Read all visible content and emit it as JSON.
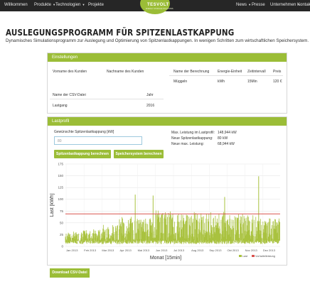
{
  "nav": {
    "left": [
      {
        "label": "Willkommen",
        "caret": false
      },
      {
        "label": "Produkte",
        "caret": true
      },
      {
        "label": "Technologien",
        "caret": true
      },
      {
        "label": "Projekte",
        "caret": false
      }
    ],
    "right": [
      {
        "label": "News",
        "caret": true
      },
      {
        "label": "Presse",
        "caret": false
      },
      {
        "label": "Unternehmen",
        "caret": true
      },
      {
        "label": "Kontakt",
        "caret": false
      }
    ],
    "logo": "TESVOLT",
    "logo_sub": "ENERGY STORAGE SOLUTIONS"
  },
  "page": {
    "title": "AUSLEGUNGSPROGRAMM FÜR SPITZENLASTKAPPUNG",
    "subtitle": "Dynamisches Simulationsprogramm zur Auslegung und Optimierung von Spitzenlastkappungen. In wenigen Schritten zum wirtschaftlichen Speichersystem."
  },
  "settings": {
    "header": "Einstellungen",
    "customer_first_label": "Vorname des Kunden",
    "customer_last_label": "Nachname des Kunden",
    "calc_name_label": "Name der Berechnung",
    "energy_unit_label": "Energie-Einheit",
    "time_interval_label": "Zeitintervall",
    "price_label": "Preis",
    "calc_name_value": "Müggeln",
    "energy_unit_value": "kWh",
    "time_interval_value": "15Min",
    "price_value": "120 €",
    "csv_name_label": "Name der CSV-Datei",
    "year_label": "Jahr",
    "csv_name_value": "Lastgang",
    "year_value": "2016"
  },
  "lastprofil": {
    "header": "Lastprofil",
    "input_label": "Gewünschte Spitzenlastkappung [kW]",
    "input_placeholder": "80",
    "btn_calc": "Spitzenlastkappung berechnen",
    "btn_system": "Speichersystem berechnen",
    "stats": [
      {
        "label": "Max. Leistung im Lastprofil:",
        "value": "148,944 kW"
      },
      {
        "label": "Neue Spitzenlastkappung:",
        "value": "80 kW"
      },
      {
        "label": "Neue max. Leistung:",
        "value": "68,944 kW"
      }
    ]
  },
  "download_label": "Download CSV-Datei",
  "chart_data": {
    "type": "line",
    "xlabel": "Monat [15min]",
    "ylabel": "Last [kWh]",
    "ylim": [
      0,
      175
    ],
    "yticks": [
      0,
      25,
      50,
      75,
      100,
      125,
      150,
      175
    ],
    "xticks": [
      "Jan 2013",
      "Feb 2013",
      "Mar 2013",
      "Apr 2013",
      "Mai 2013",
      "Jun 2013",
      "Jul 2013",
      "Aug 2013",
      "Sep 2013",
      "Okt 2013",
      "Nov 2013",
      "Dez 2013"
    ],
    "grid": true,
    "legend_position": "bottom-right",
    "colors": {
      "load": "#a9c23f",
      "threshold": "#d9534f"
    },
    "series": [
      {
        "name": "Last",
        "monthly_typical_peak": [
          30,
          35,
          45,
          60,
          60,
          75,
          70,
          70,
          70,
          68,
          65,
          60
        ],
        "max": 148.944
      },
      {
        "name": "Vorhaltelleistung",
        "constant": 68.944
      }
    ],
    "notable_peaks": [
      {
        "month_index": 3.9,
        "value": 110
      },
      {
        "month_index": 4.9,
        "value": 108
      },
      {
        "month_index": 8.9,
        "value": 105
      },
      {
        "month_index": 10.8,
        "value": 148.944
      }
    ]
  }
}
